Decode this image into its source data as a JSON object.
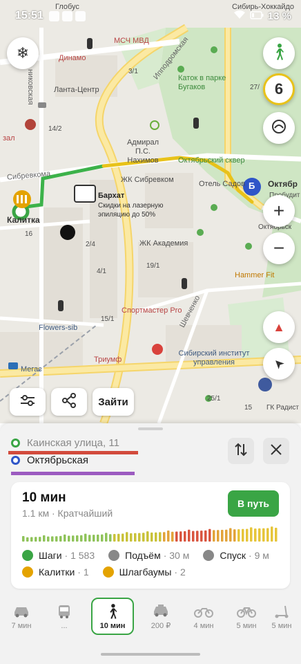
{
  "status_bar": {
    "time": "15:51",
    "battery": "13 %"
  },
  "map": {
    "labels": {
      "globus": "Глобус",
      "sibir_hokkaido": "Сибирь-Хоккайдо",
      "msch_mvd": "МСЧ МВД",
      "dinamo": "Динамо",
      "ippodromskaya": "Ипподромская",
      "katok": "Каток в парке Бугаков",
      "lanta": "Ланта-Центр",
      "no3_1": "3/1",
      "no27": "27/",
      "no14_2": "14/2",
      "zal": "зал",
      "admiral": "Адмирал П.С. Нахимов",
      "sibrevkoma": "Сибревкома",
      "jk_sibrevkom": "ЖК Сибревком",
      "oktyabrsky_skver": "Октябрьский сквер",
      "otel_sadovaya": "Отель Садов",
      "oktyabr_top": "Октябр",
      "probudit": "Пробудит",
      "barkhat": "Бархат",
      "barkhat_sub": "Скидки на лазерную эпиляцию до 50%",
      "kalitka_label": "Калитка",
      "no16": "16",
      "no2_4": "2/4",
      "jk_akademiya": "ЖК Академия",
      "oktyabrskaya_right": "Октябрьск",
      "hammer_fit": "Hammer Fit",
      "no4_1": "4/1",
      "no19_1": "19/1",
      "sportmaster": "Спортмастер Pro",
      "flowers_sib": "Flowers-sib",
      "no15_1": "15/1",
      "shevchenko": "Шевченко",
      "megas": "Мегас",
      "triumf": "Триумф",
      "sib_institut": "Сибирский институт управления",
      "no25_1": "25/1",
      "no15": "15",
      "gk_radist": "ГК Радист",
      "marker_b": "Б",
      "nikovskaya": "никовская"
    }
  },
  "map_controls": {
    "snowflake": "❄",
    "counter": "6",
    "zoom_in": "+",
    "zoom_out": "−",
    "compass": "▲",
    "locate": "➤"
  },
  "toolbar": {
    "enter_label": "Зайти"
  },
  "route": {
    "from": "Каинская улица, 11",
    "to": "Октябрьская",
    "duration": "10 мин",
    "summary": "1.1 км · Кратчайший",
    "go_label": "В путь",
    "stats": {
      "steps_label": "Шаги",
      "steps_value": "· 1 583",
      "ascent_label": "Подъём",
      "ascent_value": "· 30 м",
      "descent_label": "Спуск",
      "descent_value": "· 9 м",
      "gates_label": "Калитки",
      "gates_value": "· 1",
      "barriers_label": "Шлагбаумы",
      "barriers_value": "· 2"
    }
  },
  "modes": [
    {
      "name": "car",
      "label": "7 мин"
    },
    {
      "name": "transit",
      "label": "..."
    },
    {
      "name": "walk",
      "label": "10 мин"
    },
    {
      "name": "taxi",
      "label": "200 ₽"
    },
    {
      "name": "moto",
      "label": "4 мин"
    },
    {
      "name": "bike",
      "label": "5 мин"
    },
    {
      "name": "scooter",
      "label": "5 мин"
    }
  ],
  "colors": {
    "accent_green": "#3aa545",
    "point_b_blue": "#2f55c8",
    "route_green": "#3cb24a",
    "route_yellow": "#e8c21a",
    "annotation_red": "#d24b3c",
    "annotation_purple": "#9c5bc0"
  }
}
